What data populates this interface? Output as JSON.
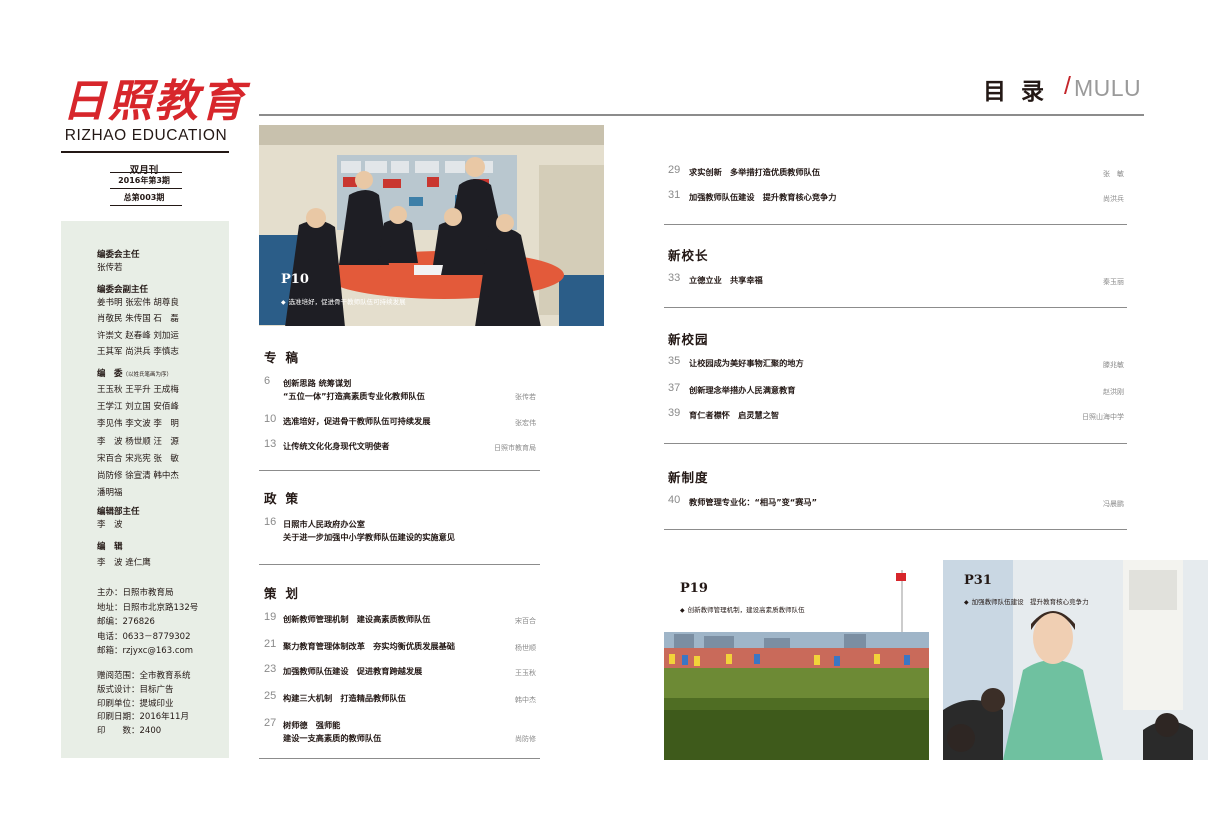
{
  "masthead": {
    "logo_cn": "日照教育",
    "logo_en": "RIZHAO EDUCATION",
    "frequency": "双月刊",
    "issue": "2016年第3期",
    "total_issue": "总第003期"
  },
  "credits": {
    "chief_editor_label": "编委会主任",
    "chief_editor": "张传若",
    "deputy_label": "编委会副主任",
    "deputy_rows": [
      [
        "姜书明",
        "张宏伟",
        "胡尊良"
      ],
      [
        "肖敬民",
        "朱传国",
        "石　磊"
      ],
      [
        "许崇文",
        "赵春峰",
        "刘加运"
      ],
      [
        "王其军",
        "尚洪兵",
        "李慎志"
      ]
    ],
    "members_label": "编　委",
    "members_note": "（以姓氏笔画为序）",
    "member_rows": [
      [
        "王玉秋",
        "王平升",
        "王成梅"
      ],
      [
        "王学江",
        "刘立国",
        "安佰峰"
      ],
      [
        "李见伟",
        "李文波",
        "李　明"
      ],
      [
        "李　波",
        "杨世顺",
        "汪　源"
      ],
      [
        "宋百合",
        "宋兆宪",
        "张　敏"
      ],
      [
        "尚防修",
        "徐宣清",
        "韩中杰"
      ],
      [
        "潘明福"
      ]
    ],
    "office_label": "编辑部主任",
    "office_head": "李　波",
    "editors_label": "编　辑",
    "editors": [
      "李　波",
      "逄仁鹰"
    ],
    "info": [
      "主办：日照市教育局",
      "地址：日照市北京路132号",
      "邮编：276826",
      "电话：0633－8779302",
      "邮箱：rzjyxc@163.com"
    ],
    "print": [
      "赠阅范围：全市教育系统",
      "版式设计：目标广告",
      "印刷单位：提城印业",
      "印刷日期：2016年11月",
      "印　　数：2400"
    ]
  },
  "title": {
    "cn": "目录",
    "slash": "/",
    "en": "MULU"
  },
  "photos": {
    "p10": {
      "page": "P10",
      "caption": "选准培好，促进骨干教师队伍可持续发展"
    },
    "p19": {
      "page": "P19",
      "caption": "创新教师管理机制，建设高素质教师队伍"
    },
    "p31": {
      "page": "P31",
      "caption": "加强教师队伍建设　提升教育核心竞争力"
    }
  },
  "toc": {
    "zhuangao": {
      "heading": "专稿",
      "items": [
        {
          "page": "6",
          "line1": "创新思路 统筹谋划",
          "line2": "“五位一体”打造高素质专业化教师队伍",
          "author": "张传若"
        },
        {
          "page": "10",
          "line1": "选准培好，促进骨干教师队伍可持续发展",
          "author": "张宏伟"
        },
        {
          "page": "13",
          "line1": "让传统文化化身现代文明使者",
          "author": "日照市教育局"
        }
      ]
    },
    "zhengce": {
      "heading": "政策",
      "items": [
        {
          "page": "16",
          "line1": "日照市人民政府办公室",
          "line2": "关于进一步加强中小学教师队伍建设的实施意见"
        }
      ]
    },
    "cehua": {
      "heading": "策划",
      "items": [
        {
          "page": "19",
          "line1": "创新教师管理机制　建设高素质教师队伍",
          "author": "宋百合"
        },
        {
          "page": "21",
          "line1": "聚力教育管理体制改革　夯实均衡优质发展基础",
          "author": "杨世顺"
        },
        {
          "page": "23",
          "line1": "加强教师队伍建设　促进教育跨越发展",
          "author": "王玉秋"
        },
        {
          "page": "25",
          "line1": "构建三大机制　打造精品教师队伍",
          "author": "韩中杰"
        },
        {
          "page": "27",
          "line1": "树师德　强师能",
          "line2": "建设一支高素质的教师队伍",
          "author": "尚防修"
        }
      ]
    },
    "cont": {
      "items": [
        {
          "page": "29",
          "line1": "求实创新　多举措打造优质教师队伍",
          "author": "张　敏"
        },
        {
          "page": "31",
          "line1": "加强教师队伍建设　提升教育核心竞争力",
          "author": "尚洪兵"
        }
      ]
    },
    "xiaozhang": {
      "heading": "新校长",
      "items": [
        {
          "page": "33",
          "line1": "立德立业　共享幸福",
          "author": "秦玉丽"
        }
      ]
    },
    "xiaoyuan": {
      "heading": "新校园",
      "items": [
        {
          "page": "35",
          "line1": "让校园成为美好事物汇聚的地方",
          "author": "滕兆敏"
        },
        {
          "page": "37",
          "line1": "创新理念举措办人民满意教育",
          "author": "赵洪刚"
        },
        {
          "page": "39",
          "line1": "育仁者襟怀　启灵慧之智",
          "author": "日照山海中学"
        }
      ]
    },
    "zhidu": {
      "heading": "新制度",
      "items": [
        {
          "page": "40",
          "line1": "教师管理专业化：“相马”变“赛马”",
          "author": "冯晨鹏"
        }
      ]
    }
  },
  "colors": {
    "brand_red": "#d7262b",
    "panel_green": "#e8eee6",
    "rule_gray": "#8c8c8c"
  }
}
